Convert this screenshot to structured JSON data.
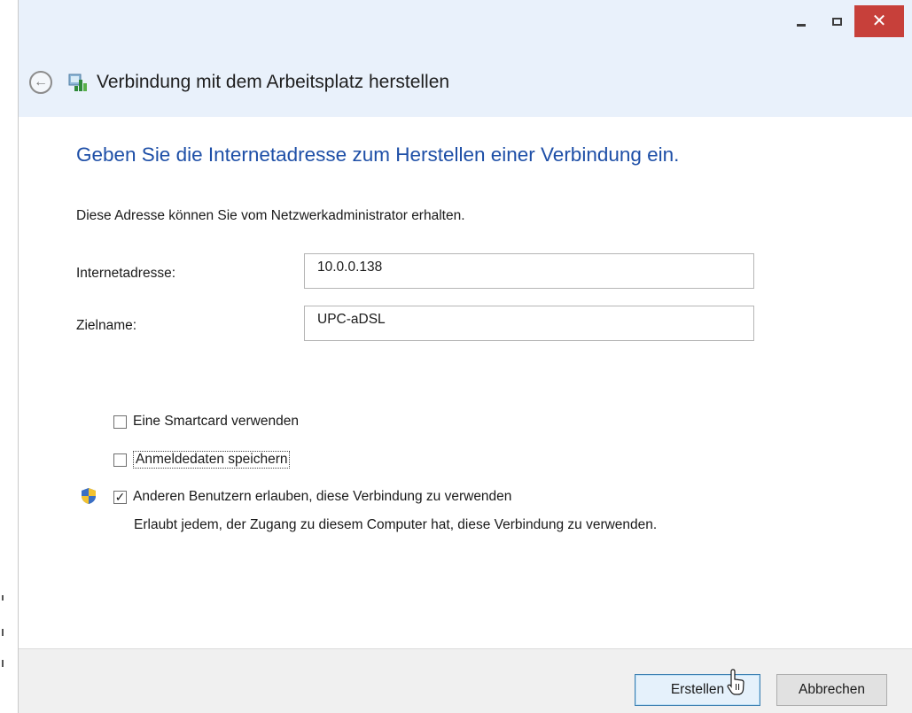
{
  "window": {
    "title": "Verbindung mit dem Arbeitsplatz herstellen",
    "caption_buttons": [
      "minimize-icon",
      "maximize-icon",
      "close-icon"
    ],
    "close_glyph": "✕",
    "back_glyph": "←"
  },
  "page": {
    "heading": "Geben Sie die Internetadresse zum Herstellen einer Verbindung ein.",
    "instruction": "Diese Adresse können Sie vom Netzwerkadministrator erhalten."
  },
  "fields": {
    "internet_address_label": "Internetadresse:",
    "internet_address_value": "10.0.0.138",
    "destination_label": "Zielname:",
    "destination_value": "UPC-aDSL"
  },
  "options": {
    "smartcard_label": "Eine Smartcard verwenden",
    "smartcard_checked": false,
    "save_credentials_label": "Anmeldedaten speichern",
    "save_credentials_checked": false,
    "allow_others_label": "Anderen Benutzern erlauben, diese Verbindung zu verwenden",
    "allow_others_checked": true,
    "allow_others_description": "Erlaubt jedem, der Zugang zu diesem Computer hat, diese Verbindung zu verwenden.",
    "check_glyph": "✓"
  },
  "buttons": {
    "create_label": "Erstellen",
    "cancel_label": "Abbrechen"
  },
  "colors": {
    "heading": "#1e4fa7",
    "close_button": "#c7403a",
    "titlebar": "#e9f1fb"
  }
}
